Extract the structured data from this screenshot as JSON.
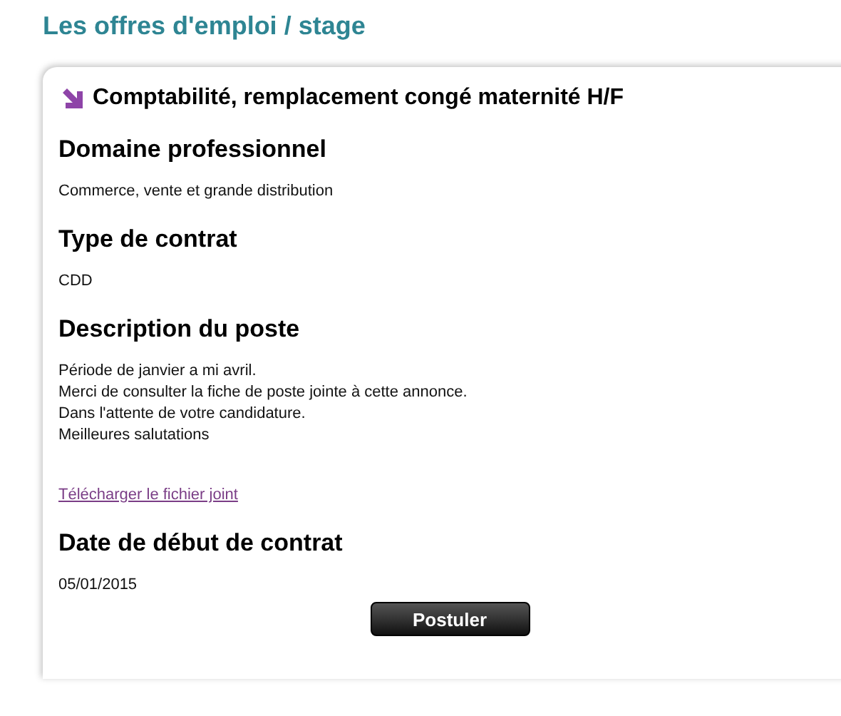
{
  "page_title": "Les offres d'emploi / stage",
  "offer": {
    "title": "Comptabilité, remplacement congé maternité H/F",
    "sections": [
      {
        "kind": "text",
        "heading": "Domaine professionnel",
        "lines": [
          "Commerce, vente et grande distribution"
        ]
      },
      {
        "kind": "text",
        "heading": "Type de contrat",
        "lines": [
          "CDD"
        ]
      },
      {
        "kind": "text",
        "heading": "Description du poste",
        "lines": [
          "Période de janvier a mi avril.",
          "Merci de consulter la fiche de poste jointe à cette annonce.",
          "Dans l'attente de votre candidature.",
          "Meilleures salutations"
        ]
      },
      {
        "kind": "link",
        "label": "Télécharger le fichier joint"
      },
      {
        "kind": "text",
        "heading": "Date de début de contrat",
        "lines": [
          "05/01/2015"
        ]
      }
    ],
    "button": "Postuler"
  }
}
